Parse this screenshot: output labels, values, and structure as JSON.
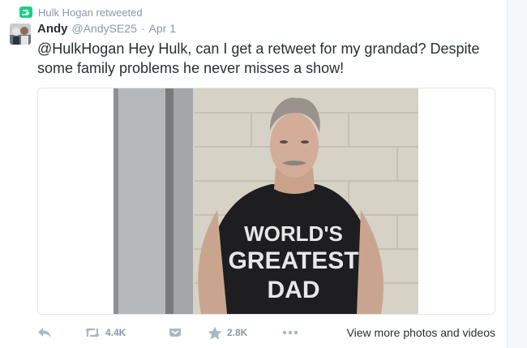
{
  "retweet_context": {
    "label": "Hulk Hogan retweeted",
    "icon": "retweet-icon",
    "color": "#19cf86"
  },
  "tweet": {
    "fullname": "Andy",
    "username": "@AndySE25",
    "separator": "·",
    "time": "Apr 1",
    "text_line1": "@HulkHogan Hey Hulk, can I get a retweet for my grandad? Despite",
    "text_line2": "some family problems he never misses a show!"
  },
  "media": {
    "photo": "man-in-shirt-photo",
    "shirt_text_line1": "WORLD'S",
    "shirt_text_line2": "GREATEST",
    "shirt_text_line3": "DAD"
  },
  "actions": {
    "reply_icon": "reply-icon",
    "retweet_icon": "retweet-icon",
    "retweet_count": "4.4K",
    "dm_icon": "inbox-icon",
    "like_icon": "star-icon",
    "like_count": "2.8K",
    "more_icon": "more-icon",
    "more_media_label": "View more photos and videos"
  },
  "colors": {
    "text": "#292f33",
    "muted": "#8899a6",
    "border": "#e1e8ed"
  }
}
